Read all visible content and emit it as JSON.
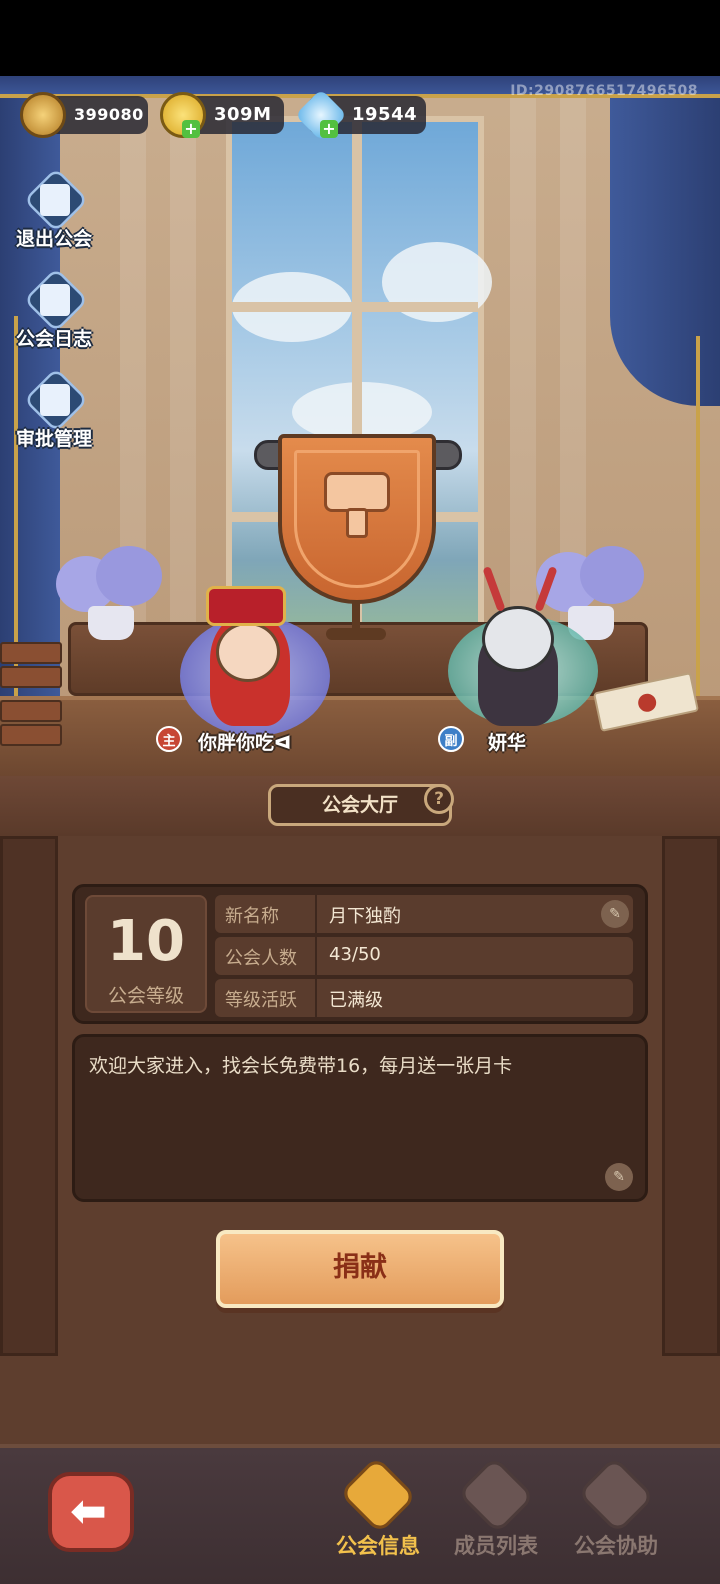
{
  "header": {
    "uid": "ID:2908766517496508",
    "currencies": [
      {
        "name": "medal-currency",
        "value": "399080",
        "color": "#d9a441"
      },
      {
        "name": "gold-coin",
        "value": "309M",
        "color": "#f0c234"
      },
      {
        "name": "crystal",
        "value": "19544",
        "color": "#7fc4f0"
      }
    ]
  },
  "sidebar": {
    "items": [
      {
        "label": "退出公会",
        "icon": "exit-door-icon"
      },
      {
        "label": "公会日志",
        "icon": "log-book-icon"
      },
      {
        "label": "审批管理",
        "icon": "approval-document-icon"
      }
    ]
  },
  "heroes": {
    "leader": {
      "role": "主",
      "name": "你胖你吃ᐊ"
    },
    "deputy": {
      "role": "副",
      "name": "妍华"
    }
  },
  "hall": {
    "title": "公会大厅",
    "help": "?"
  },
  "guild": {
    "level": "10",
    "level_label": "公会等级",
    "rows": [
      {
        "key": "新名称",
        "value": "月下独酌"
      },
      {
        "key": "公会人数",
        "value": "43/50"
      },
      {
        "key": "等级活跃",
        "value": "已满级"
      }
    ],
    "notice": "欢迎大家进入，找会长免费带16，每月送一张月卡",
    "donate_label": "捐献"
  },
  "navbar": {
    "tabs": [
      {
        "label": "公会信息",
        "active": true,
        "color": "#f2c14c"
      },
      {
        "label": "成员列表",
        "active": false,
        "color": "#8a7770"
      },
      {
        "label": "公会协助",
        "active": false,
        "color": "#8a7770"
      }
    ]
  }
}
